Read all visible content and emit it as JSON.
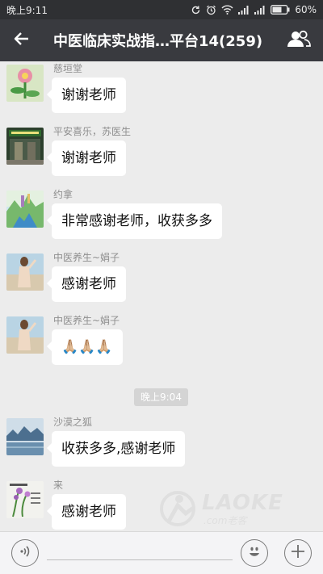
{
  "status_bar": {
    "time": "晚上9:11",
    "battery": "60%",
    "icons": [
      "refresh-icon",
      "alarm-icon",
      "wifi-icon",
      "signal-icon",
      "signal-icon",
      "battery-icon"
    ]
  },
  "header": {
    "back_icon": "arrow-left-icon",
    "title": "中医临床实战指…平台14(259)",
    "group_icon": "group-members-icon"
  },
  "messages": [
    {
      "sender": "慈垣堂",
      "text": "谢谢老师"
    },
    {
      "sender": "平安喜乐，苏医生",
      "text": "谢谢老师"
    },
    {
      "sender": "约拿",
      "text": "非常感谢老师，收获多多"
    },
    {
      "sender": "中医养生~娟子",
      "text": "感谢老师"
    },
    {
      "sender": "中医养生~娟子",
      "text": "🙏🏼🙏🏼🙏🏼"
    },
    {
      "sender": "沙漠之狐",
      "text": "收获多多,感谢老师"
    },
    {
      "sender": "来",
      "text": "感谢老师"
    }
  ],
  "time_divider": "晚上9:04",
  "watermark": {
    "text": "LAOKE",
    "sub": ".com老客"
  },
  "input_bar": {
    "voice_icon": "voice-icon",
    "emoji_icon": "emoji-icon",
    "more_icon": "plus-icon"
  }
}
